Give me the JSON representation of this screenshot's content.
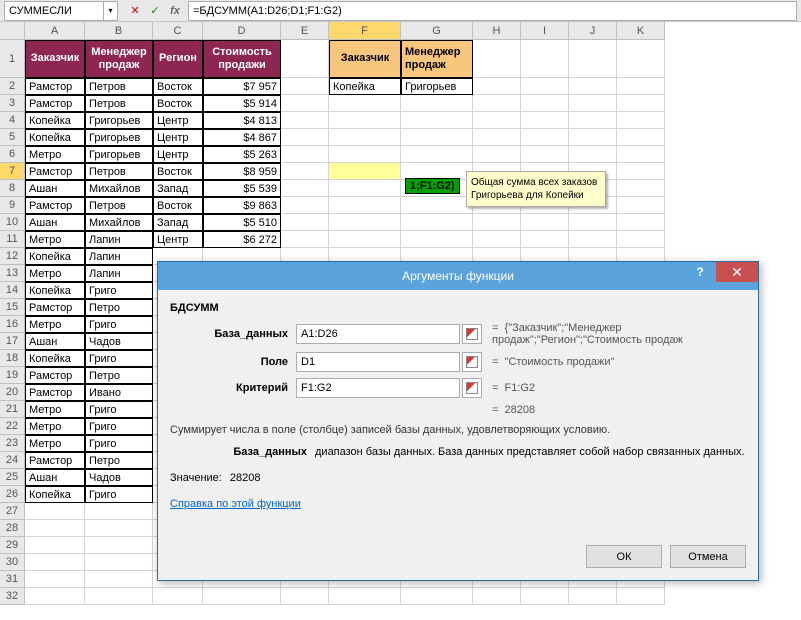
{
  "name_box": "СУММЕСЛИ",
  "formula": "=БДСУММ(A1:D26;D1;F1:G2)",
  "columns": [
    "A",
    "B",
    "C",
    "D",
    "E",
    "F",
    "G",
    "H",
    "I",
    "J",
    "K"
  ],
  "header_row": [
    "Заказчик",
    "Менеджер продаж",
    "Регион",
    "Стоимость продажи"
  ],
  "data_rows": [
    {
      "a": "Рамстор",
      "b": "Петров",
      "c": "Восток",
      "d": "$7 957"
    },
    {
      "a": "Рамстор",
      "b": "Петров",
      "c": "Восток",
      "d": "$5 914"
    },
    {
      "a": "Копейка",
      "b": "Григорьев",
      "c": "Центр",
      "d": "$4 813"
    },
    {
      "a": "Копейка",
      "b": "Григорьев",
      "c": "Центр",
      "d": "$4 867"
    },
    {
      "a": "Метро",
      "b": "Григорьев",
      "c": "Центр",
      "d": "$5 263"
    },
    {
      "a": "Рамстор",
      "b": "Петров",
      "c": "Восток",
      "d": "$8 959"
    },
    {
      "a": "Ашан",
      "b": "Михайлов",
      "c": "Запад",
      "d": "$5 539"
    },
    {
      "a": "Рамстор",
      "b": "Петров",
      "c": "Восток",
      "d": "$9 863"
    },
    {
      "a": "Ашан",
      "b": "Михайлов",
      "c": "Запад",
      "d": "$5 510"
    },
    {
      "a": "Метро",
      "b": "Лапин",
      "c": "Центр",
      "d": "$6 272"
    },
    {
      "a": "Копейка",
      "b": "Лапин",
      "c": "",
      "d": ""
    },
    {
      "a": "Метро",
      "b": "Лапин",
      "c": "",
      "d": ""
    },
    {
      "a": "Копейка",
      "b": "Григо",
      "c": "",
      "d": ""
    },
    {
      "a": "Рамстор",
      "b": "Петро",
      "c": "",
      "d": ""
    },
    {
      "a": "Метро",
      "b": "Григо",
      "c": "",
      "d": ""
    },
    {
      "a": "Ашан",
      "b": "Чадов",
      "c": "",
      "d": ""
    },
    {
      "a": "Копейка",
      "b": "Григо",
      "c": "",
      "d": ""
    },
    {
      "a": "Рамстор",
      "b": "Петро",
      "c": "",
      "d": ""
    },
    {
      "a": "Рамстор",
      "b": "Ивано",
      "c": "",
      "d": ""
    },
    {
      "a": "Метро",
      "b": "Григо",
      "c": "",
      "d": ""
    },
    {
      "a": "Метро",
      "b": "Григо",
      "c": "",
      "d": ""
    },
    {
      "a": "Метро",
      "b": "Григо",
      "c": "",
      "d": ""
    },
    {
      "a": "Рамстор",
      "b": "Петро",
      "c": "",
      "d": ""
    },
    {
      "a": "Ашан",
      "b": "Чадов",
      "c": "",
      "d": ""
    },
    {
      "a": "Копейка",
      "b": "Григо",
      "c": "",
      "d": ""
    }
  ],
  "criteria_header": [
    "Заказчик",
    "Менеджер продаж"
  ],
  "criteria_row": [
    "Копейка",
    "Григорьев"
  ],
  "floating_ref": "1;F1:G2)",
  "tooltip": "Общая сумма всех заказов Григорьева для Копейки",
  "dialog": {
    "title": "Аргументы функции",
    "fn": "БДСУММ",
    "args": [
      {
        "label": "База_данных",
        "value": "A1:D26",
        "eq": "{\"Заказчик\";\"Менеджер продаж\";\"Регион\";\"Стоимость продаж"
      },
      {
        "label": "Поле",
        "value": "D1",
        "eq": "\"Стоимость продажи\""
      },
      {
        "label": "Критерий",
        "value": "F1:G2",
        "eq": "F1:G2"
      }
    ],
    "result_eq": "28208",
    "desc": "Суммирует числа в поле (столбце) записей базы данных, удовлетворяющих условию.",
    "argdesc_label": "База_данных",
    "argdesc_text": "диапазон базы данных. База данных представляет собой набор связанных данных.",
    "value_label": "Значение:",
    "value": "28208",
    "link": "Справка по этой функции",
    "ok": "ОК",
    "cancel": "Отмена"
  }
}
